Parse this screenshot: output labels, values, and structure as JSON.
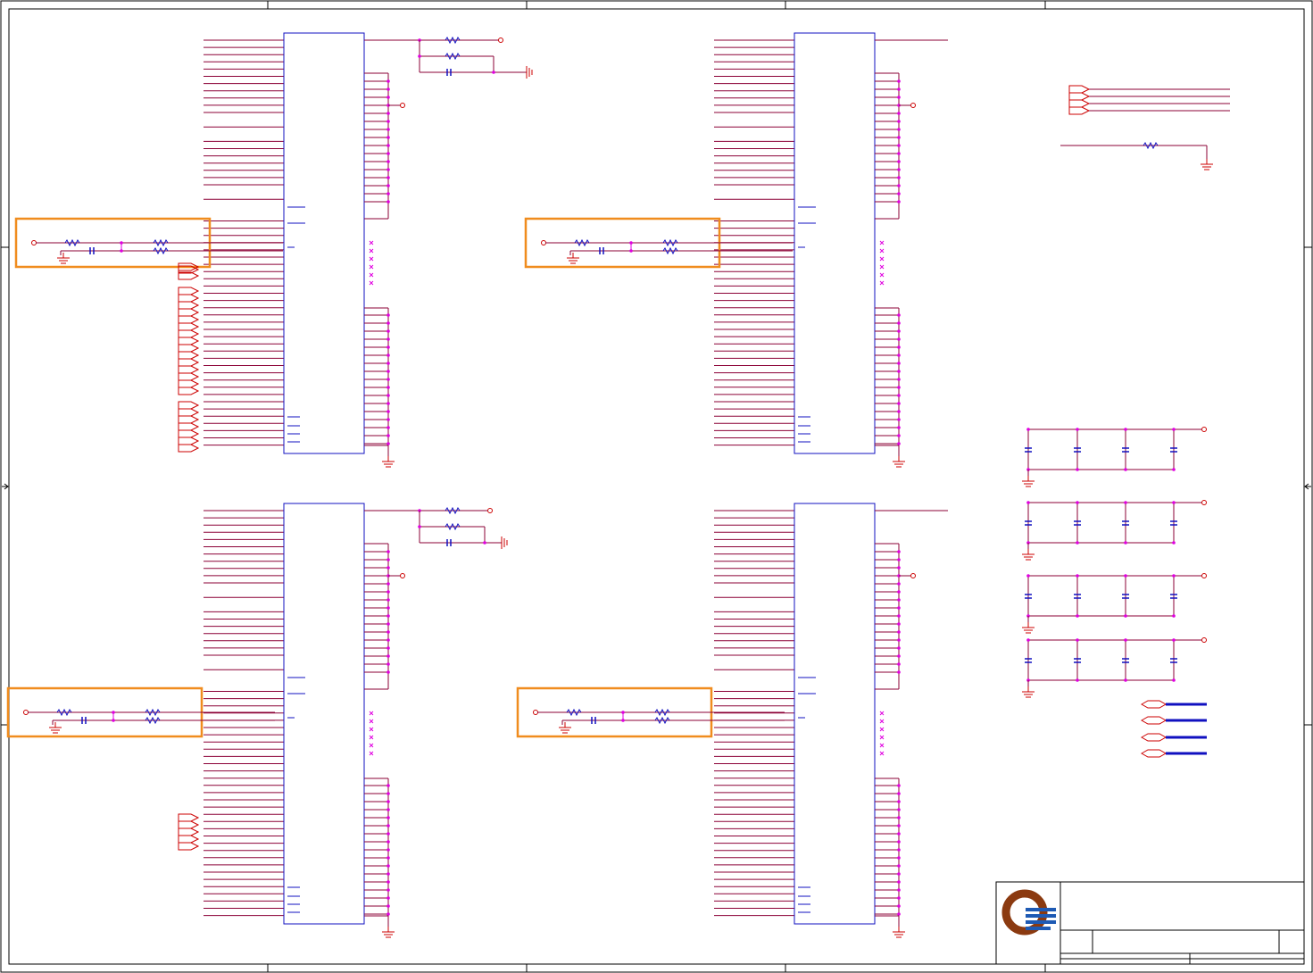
{
  "sheet": {
    "colors": {
      "frame": "#000000",
      "wire": "#8b0036",
      "body": "#1010c0",
      "junction": "#e000e0",
      "power": "#cc0000",
      "highlight": "#f08c1e",
      "logo_ring": "#8b3a10",
      "logo_bars": "#1e5ab4"
    },
    "logo_icon": "company-logo-icon"
  },
  "chips": [
    {
      "id": "u1",
      "name": "chip-top-left",
      "highlighted_network": "rc-network-top-left"
    },
    {
      "id": "u2",
      "name": "chip-top-right",
      "highlighted_network": "rc-network-top-right"
    },
    {
      "id": "u3",
      "name": "chip-bottom-left",
      "highlighted_network": "rc-network-bottom-left"
    },
    {
      "id": "u4",
      "name": "chip-bottom-right",
      "highlighted_network": "rc-network-bottom-right"
    }
  ],
  "decoupling": {
    "banks": 4,
    "capacitors_per_bank": 4
  },
  "title_block": {
    "fields": []
  }
}
